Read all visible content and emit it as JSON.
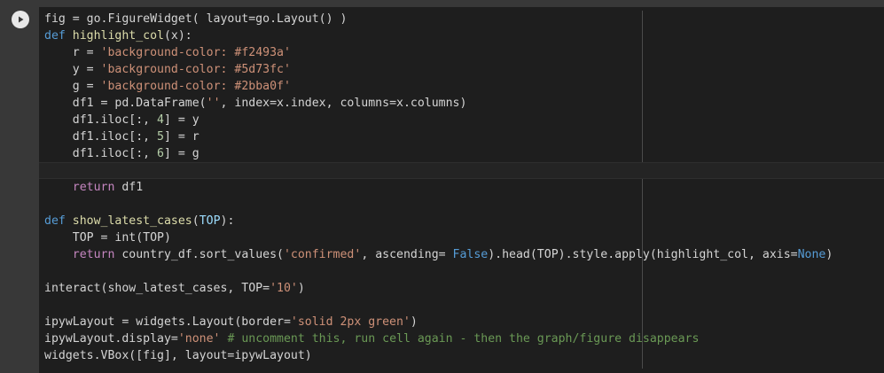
{
  "run_button": {
    "icon": "play-icon"
  },
  "code_lines": [
    [
      {
        "t": "fig = go.FigureWidget( layout=go.Layout() )",
        "c": ""
      }
    ],
    [
      {
        "t": "def ",
        "c": "const"
      },
      {
        "t": "highlight_col",
        "c": "fn"
      },
      {
        "t": "(x):",
        "c": ""
      }
    ],
    [
      {
        "t": "    r = ",
        "c": ""
      },
      {
        "t": "'background-color: #f2493a'",
        "c": "str"
      }
    ],
    [
      {
        "t": "    y = ",
        "c": ""
      },
      {
        "t": "'background-color: #5d73fc'",
        "c": "str"
      }
    ],
    [
      {
        "t": "    g = ",
        "c": ""
      },
      {
        "t": "'background-color: #2bba0f'",
        "c": "str"
      }
    ],
    [
      {
        "t": "    df1 = pd.DataFrame(",
        "c": ""
      },
      {
        "t": "''",
        "c": "str"
      },
      {
        "t": ", index=x.index, columns=x.columns)",
        "c": ""
      }
    ],
    [
      {
        "t": "    df1.iloc[:, ",
        "c": ""
      },
      {
        "t": "4",
        "c": "num"
      },
      {
        "t": "] = y",
        "c": ""
      }
    ],
    [
      {
        "t": "    df1.iloc[:, ",
        "c": ""
      },
      {
        "t": "5",
        "c": "num"
      },
      {
        "t": "] = r",
        "c": ""
      }
    ],
    [
      {
        "t": "    df1.iloc[:, ",
        "c": ""
      },
      {
        "t": "6",
        "c": "num"
      },
      {
        "t": "] = g",
        "c": ""
      }
    ],
    [
      {
        "t": "",
        "c": ""
      }
    ],
    [
      {
        "t": "    ",
        "c": ""
      },
      {
        "t": "return",
        "c": "kw"
      },
      {
        "t": " df1",
        "c": ""
      }
    ],
    [
      {
        "t": "",
        "c": ""
      }
    ],
    [
      {
        "t": "def ",
        "c": "const"
      },
      {
        "t": "show_latest_cases",
        "c": "fn"
      },
      {
        "t": "(",
        "c": ""
      },
      {
        "t": "TOP",
        "c": "var"
      },
      {
        "t": "):",
        "c": ""
      }
    ],
    [
      {
        "t": "    TOP = int(TOP)",
        "c": ""
      }
    ],
    [
      {
        "t": "    ",
        "c": ""
      },
      {
        "t": "return",
        "c": "kw"
      },
      {
        "t": " country_df.sort_values(",
        "c": ""
      },
      {
        "t": "'confirmed'",
        "c": "str"
      },
      {
        "t": ", ascending= ",
        "c": ""
      },
      {
        "t": "False",
        "c": "const"
      },
      {
        "t": ").head(TOP).style.apply(highlight_col, axis=",
        "c": ""
      },
      {
        "t": "None",
        "c": "const"
      },
      {
        "t": ")",
        "c": ""
      }
    ],
    [
      {
        "t": "",
        "c": ""
      }
    ],
    [
      {
        "t": "interact(show_latest_cases, TOP=",
        "c": ""
      },
      {
        "t": "'10'",
        "c": "str"
      },
      {
        "t": ")",
        "c": ""
      }
    ],
    [
      {
        "t": "",
        "c": ""
      }
    ],
    [
      {
        "t": "ipywLayout = widgets.Layout(border=",
        "c": ""
      },
      {
        "t": "'solid 2px green'",
        "c": "str"
      },
      {
        "t": ")",
        "c": ""
      }
    ],
    [
      {
        "t": "ipywLayout.display=",
        "c": ""
      },
      {
        "t": "'none'",
        "c": "str"
      },
      {
        "t": " ",
        "c": ""
      },
      {
        "t": "# uncomment this, run cell again - then the graph/figure disappears",
        "c": "cmt"
      }
    ],
    [
      {
        "t": "widgets.VBox([fig], layout=ipywLayout)",
        "c": ""
      }
    ]
  ]
}
